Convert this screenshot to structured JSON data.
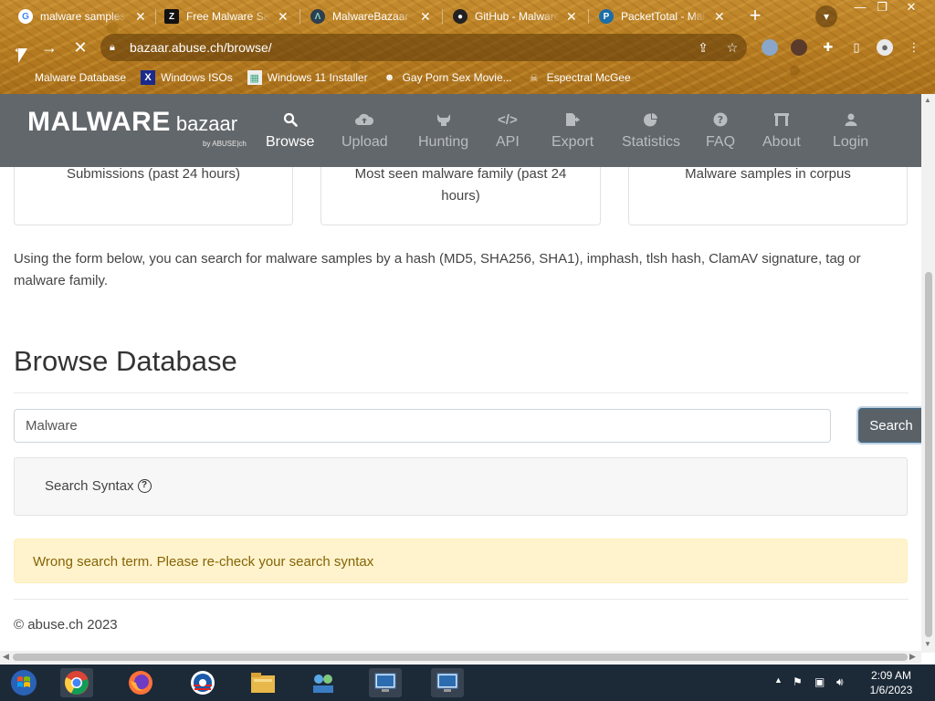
{
  "browser": {
    "tabs": [
      {
        "title": "malware samples d",
        "favicon": "google-icon",
        "active": false
      },
      {
        "title": "Free Malware Sar",
        "favicon": "zeltser-icon",
        "active": false
      },
      {
        "title": "MalwareBazaar | ",
        "favicon": "bazaar-icon",
        "active": true
      },
      {
        "title": "GitHub - Malware",
        "favicon": "github-icon",
        "active": false
      },
      {
        "title": "PacketTotal - Mal",
        "favicon": "packettotal-icon",
        "active": false
      }
    ],
    "url": "bazaar.abuse.ch/browse/",
    "bookmarks": [
      {
        "label": "Malware Database",
        "icon": "folder-icon"
      },
      {
        "label": "Windows ISOs",
        "icon": "x-icon"
      },
      {
        "label": "Windows 11 Installer",
        "icon": "image-icon"
      },
      {
        "label": "Gay Porn Sex Movie...",
        "icon": "face-icon"
      },
      {
        "label": "Espectral McGee",
        "icon": "skull-icon"
      }
    ]
  },
  "site": {
    "logo_main": "MALWARE",
    "logo_sub": "bazaar",
    "logo_by": "by ABUSE|ch",
    "nav": [
      {
        "label": "Browse",
        "icon": "search-icon",
        "active": true
      },
      {
        "label": "Upload",
        "icon": "cloud-upload-icon",
        "active": false
      },
      {
        "label": "Hunting",
        "icon": "hunting-icon",
        "active": false
      },
      {
        "label": "API",
        "icon": "code-icon",
        "active": false
      },
      {
        "label": "Export",
        "icon": "export-icon",
        "active": false
      },
      {
        "label": "Statistics",
        "icon": "pie-chart-icon",
        "active": false
      },
      {
        "label": "FAQ",
        "icon": "question-icon",
        "active": false
      },
      {
        "label": "About",
        "icon": "building-icon",
        "active": false
      },
      {
        "label": "Login",
        "icon": "user-icon",
        "active": false
      }
    ]
  },
  "stats_cards": [
    {
      "label": "Submissions (past 24 hours)"
    },
    {
      "label": "Most seen malware family (past 24 hours)"
    },
    {
      "label": "Malware samples in corpus"
    }
  ],
  "intro_text": "Using the form below, you can search for malware samples by a hash (MD5, SHA256, SHA1), imphash, tlsh hash, ClamAV signature, tag or malware family.",
  "page_title": "Browse Database",
  "search": {
    "value": "Malware",
    "button_label": "Search"
  },
  "syntax_label": "Search Syntax",
  "alert_text": "Wrong search term. Please re-check your search syntax",
  "footer_text": "© abuse.ch 2023",
  "taskbar": {
    "time": "2:09 AM",
    "date": "1/6/2023"
  }
}
